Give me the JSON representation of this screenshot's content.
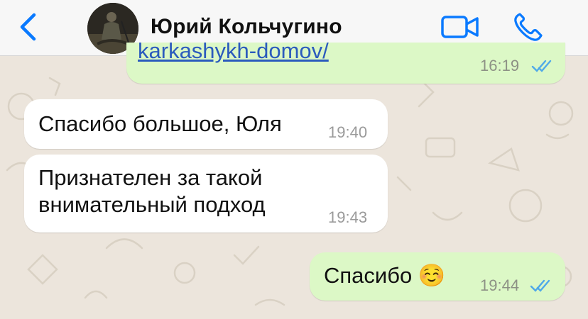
{
  "header": {
    "back_icon": "chevron-left-icon",
    "contact_name": "Юрий Кольчугино",
    "video_icon": "video-camera-icon",
    "call_icon": "phone-icon"
  },
  "messages": [
    {
      "direction": "out",
      "text": "karkashykh-domov/",
      "time": "16:19",
      "status": "read"
    },
    {
      "direction": "in",
      "text": "Спасибо большое, Юля",
      "time": "19:40"
    },
    {
      "direction": "in",
      "lines": [
        "Признателен за такой",
        "внимательный подход"
      ],
      "time": "19:43"
    },
    {
      "direction": "out",
      "text": "Спасибо ☺️",
      "time": "19:44",
      "status": "read"
    }
  ],
  "colors": {
    "accent": "#0a7aff",
    "incoming_bubble": "#ffffff",
    "outgoing_bubble": "#dcf8c6",
    "read_ticks": "#4fa9e8",
    "link": "#2b5bbd"
  }
}
